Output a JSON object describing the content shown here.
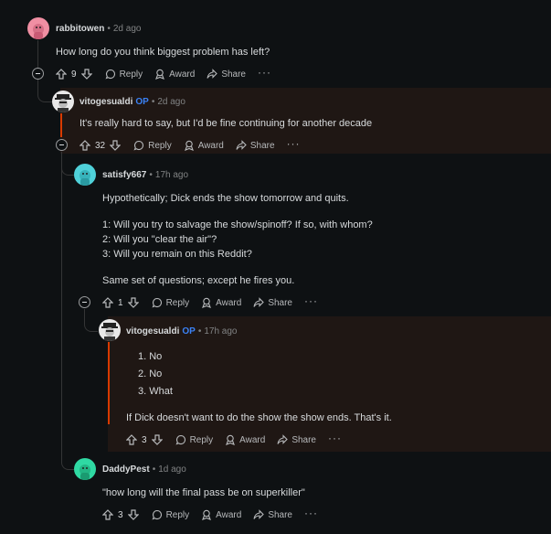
{
  "comments": [
    {
      "user": "rabbitowen",
      "op": "",
      "time": "2d ago",
      "lines": [
        "How long do you think biggest problem has left?"
      ],
      "votes": "9"
    },
    {
      "user": "vitogesualdi",
      "op": "OP",
      "time": "2d ago",
      "lines": [
        "It's really hard to say, but I'd be fine continuing for another decade"
      ],
      "votes": "32"
    },
    {
      "user": "satisfy667",
      "op": "",
      "time": "17h ago",
      "lines": [
        "Hypothetically; Dick ends the show tomorrow and quits.",
        "1: Will you try to salvage the show/spinoff? If so, with whom?",
        "2: Will you \"clear the air\"?",
        "3: Will you remain on this Reddit?",
        "Same set of questions; except he fires you."
      ],
      "votes": "1"
    },
    {
      "user": "vitogesualdi",
      "op": "OP",
      "time": "17h ago",
      "list": [
        "No",
        "No",
        "What"
      ],
      "lines": [
        "If Dick doesn't want to do the show the show ends. That's it."
      ],
      "votes": "3"
    },
    {
      "user": "DaddyPest",
      "op": "",
      "time": "1d ago",
      "lines": [
        "\"how long will the final pass be on superkiller\""
      ],
      "votes": "3"
    }
  ],
  "actions": {
    "reply": "Reply",
    "award": "Award",
    "share": "Share",
    "more": "···"
  },
  "colors": {
    "background": "#0e1113",
    "op_accent": "#d93a00",
    "op_badge": "#3b82f6",
    "avatar_pink": "#f08fa3",
    "avatar_teal": "#4fd1d9",
    "avatar_green": "#2fd9a3"
  }
}
